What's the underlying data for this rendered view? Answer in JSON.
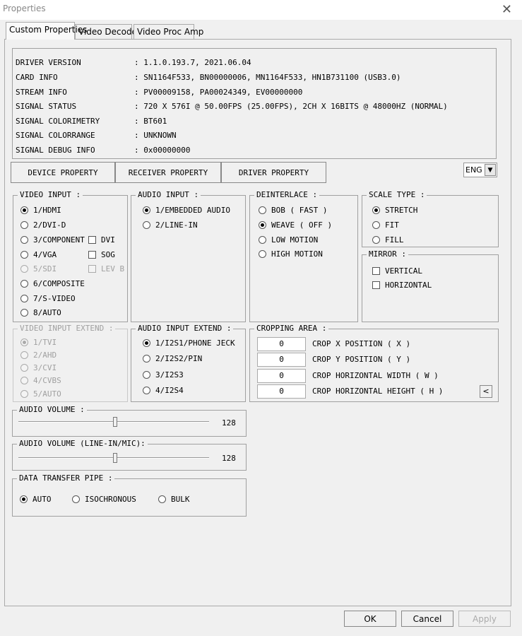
{
  "window": {
    "title": "Properties"
  },
  "tabs": [
    "Custom Properties",
    "Video Decoder",
    "Video Proc Amp"
  ],
  "info": [
    {
      "label": "DRIVER VERSION",
      "value": ": 1.1.0.193.7, 2021.06.04"
    },
    {
      "label": "CARD INFO",
      "value": ": SN1164F533, BN00000006, MN1164F533, HN1B731100 (USB3.0)"
    },
    {
      "label": "STREAM INFO",
      "value": ": PV00009158, PA00024349, EV00000000"
    },
    {
      "label": "SIGNAL STATUS",
      "value": ": 720 X 576I @ 50.00FPS (25.00FPS), 2CH X 16BITS @ 48000HZ (NORMAL)"
    },
    {
      "label": "SIGNAL COLORIMETRY",
      "value": ": BT601"
    },
    {
      "label": "SIGNAL COLORRANGE",
      "value": ": UNKNOWN"
    },
    {
      "label": "SIGNAL DEBUG INFO",
      "value": ": 0x00000000"
    }
  ],
  "property_buttons": [
    "DEVICE PROPERTY",
    "RECEIVER PROPERTY",
    "DRIVER PROPERTY"
  ],
  "language": "ENG",
  "video_input": {
    "label": "VIDEO INPUT :",
    "options": [
      "1/HDMI",
      "2/DVI-D",
      "3/COMPONENT",
      "4/VGA",
      "5/SDI",
      "6/COMPOSITE",
      "7/S-VIDEO",
      "8/AUTO"
    ],
    "checks": [
      "DVI",
      "SOG",
      "LEV B"
    ]
  },
  "audio_input": {
    "label": "AUDIO INPUT :",
    "options": [
      "1/EMBEDDED AUDIO",
      "2/LINE-IN"
    ]
  },
  "deinterlace": {
    "label": "DEINTERLACE :",
    "options": [
      "BOB ( FAST )",
      "WEAVE ( OFF )",
      "LOW MOTION",
      "HIGH MOTION"
    ]
  },
  "scale_type": {
    "label": "SCALE TYPE :",
    "options": [
      "STRETCH",
      "FIT",
      "FILL"
    ]
  },
  "mirror": {
    "label": "MIRROR :",
    "options": [
      "VERTICAL",
      "HORIZONTAL"
    ]
  },
  "video_input_extend": {
    "label": "VIDEO INPUT EXTEND :",
    "options": [
      "1/TVI",
      "2/AHD",
      "3/CVI",
      "4/CVBS",
      "5/AUTO"
    ]
  },
  "audio_input_extend": {
    "label": "AUDIO INPUT EXTEND :",
    "options": [
      "1/I2S1/PHONE JECK",
      "2/I2S2/PIN",
      "3/I2S3",
      "4/I2S4"
    ]
  },
  "cropping": {
    "label": "CROPPING AREA :",
    "fields": [
      {
        "value": "0",
        "label": "CROP X POSITION ( X )"
      },
      {
        "value": "0",
        "label": "CROP Y POSITION ( Y )"
      },
      {
        "value": "0",
        "label": "CROP HORIZONTAL WIDTH ( W )"
      },
      {
        "value": "0",
        "label": "CROP HORIZONTAL HEIGHT ( H )"
      }
    ],
    "button": "<"
  },
  "audio_volume": {
    "label": "AUDIO VOLUME :",
    "value": "128",
    "level": 0.5
  },
  "audio_volume_line": {
    "label": "AUDIO VOLUME (LINE-IN/MIC):",
    "value": "128",
    "level": 0.5
  },
  "data_pipe": {
    "label": "DATA TRANSFER PIPE :",
    "options": [
      "AUTO",
      "ISOCHRONOUS",
      "BULK"
    ]
  },
  "dialog_buttons": {
    "ok": "OK",
    "cancel": "Cancel",
    "apply": "Apply"
  }
}
